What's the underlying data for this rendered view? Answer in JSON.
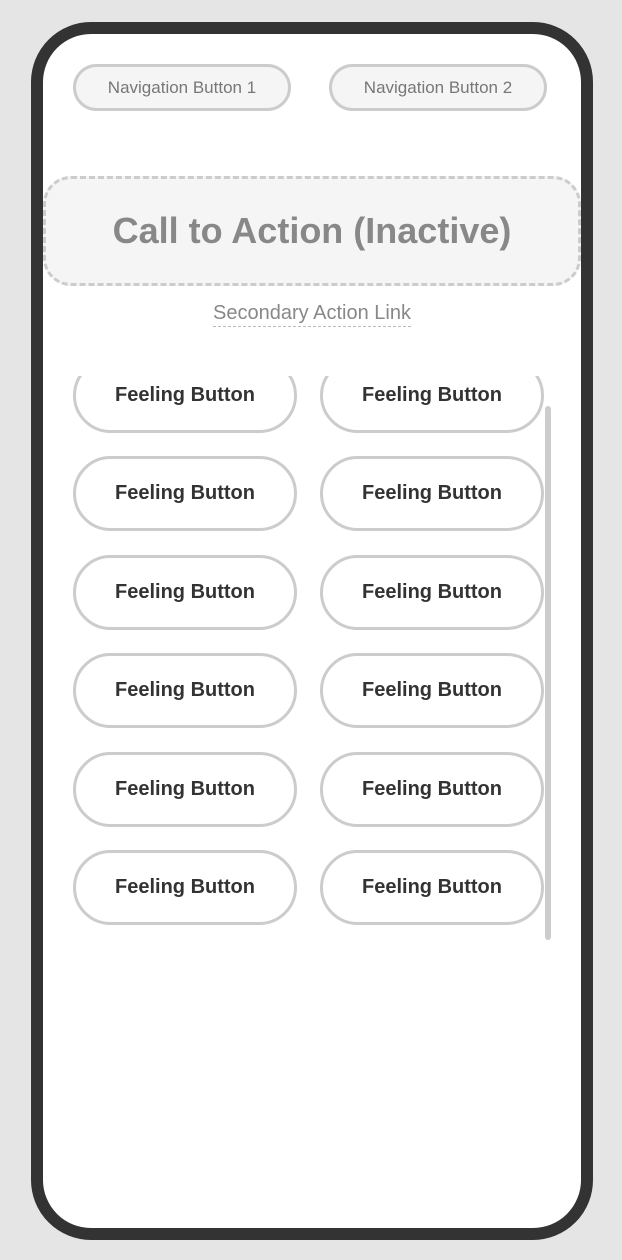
{
  "nav": {
    "button1_label": "Navigation Button 1",
    "button2_label": "Navigation Button 2"
  },
  "cta": {
    "label": "Call to Action (Inactive)"
  },
  "secondary_link": {
    "label": "Secondary Action Link"
  },
  "feelings": {
    "items": [
      "Feeling Button",
      "Feeling Button",
      "Feeling Button",
      "Feeling Button",
      "Feeling Button",
      "Feeling Button",
      "Feeling Button",
      "Feeling Button",
      "Feeling Button",
      "Feeling Button",
      "Feeling Button",
      "Feeling Button"
    ]
  },
  "colors": {
    "frame": "#333333",
    "border": "#cccccc",
    "muted_text": "#888888",
    "text": "#333333"
  }
}
